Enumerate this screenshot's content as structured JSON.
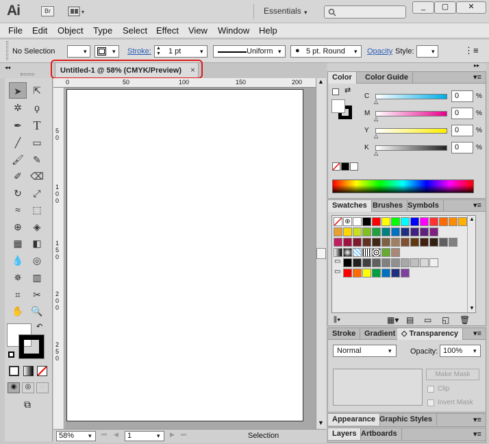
{
  "app": {
    "logo": "Ai",
    "bridge": "Br",
    "workspace": "Essentials"
  },
  "window": {
    "min": "_",
    "max": "▢",
    "close": "✕"
  },
  "menu": [
    "File",
    "Edit",
    "Object",
    "Type",
    "Select",
    "Effect",
    "View",
    "Window",
    "Help"
  ],
  "control": {
    "selection": "No Selection",
    "stroke_label": "Stroke:",
    "stroke_weight": "1 pt",
    "profile": "Uniform",
    "brush": "5 pt. Round",
    "opacity_label": "Opacity",
    "style_label": "Style:"
  },
  "document": {
    "tab_title": "Untitled-1 @ 58% (CMYK/Preview)",
    "close": "×"
  },
  "ruler": {
    "top": [
      "0",
      "50",
      "100",
      "150",
      "200"
    ],
    "left": [
      "5",
      "0",
      "1",
      "0",
      "0",
      "1",
      "5",
      "0",
      "2",
      "0",
      "0",
      "2",
      "5",
      "0"
    ]
  },
  "status": {
    "zoom": "58%",
    "page": "1",
    "mode": "Selection"
  },
  "color_panel": {
    "tabs": [
      "Color",
      "Color Guide"
    ],
    "channels": [
      {
        "label": "C",
        "value": "0",
        "pct": "%",
        "grad": "#00aee8"
      },
      {
        "label": "M",
        "value": "0",
        "pct": "%",
        "grad": "#e8008c"
      },
      {
        "label": "Y",
        "value": "0",
        "pct": "%",
        "grad": "#ffee00"
      },
      {
        "label": "K",
        "value": "0",
        "pct": "%",
        "grad": "#222222"
      }
    ]
  },
  "swatches_panel": {
    "tabs": [
      "Swatches",
      "Brushes",
      "Symbols"
    ],
    "row1": [
      "#000000",
      "#ff0000",
      "#ffff00",
      "#00ff00",
      "#00ffff",
      "#0000ff",
      "#ff00ff",
      "#ff3030",
      "#ff6a00",
      "#ff8c00",
      "#ffb000"
    ],
    "row2": [
      "#e8a030",
      "#ffd700",
      "#c8e020",
      "#80c020",
      "#20a040",
      "#008080",
      "#0070c0",
      "#203080",
      "#402080",
      "#602080",
      "#802080"
    ],
    "row3": [
      "#c02060",
      "#a01040",
      "#801830",
      "#603020",
      "#402818",
      "#806040",
      "#a08060",
      "#805030",
      "#603810",
      "#402010",
      "#302010"
    ],
    "row4": [
      "#606060",
      "#808080",
      "#a0a0a0"
    ],
    "row5": [
      "#000000",
      "#202020",
      "#404040",
      "#606060",
      "#808080",
      "#909090",
      "#a8a8a8",
      "#c0c0c0",
      "#d8d8d8",
      "#f0f0f0"
    ],
    "row6": [
      "#ff0000",
      "#ff6a00",
      "#ffff00",
      "#00a040",
      "#0070c0",
      "#203080",
      "#8040a0"
    ]
  },
  "transparency_panel": {
    "tabs": [
      "Stroke",
      "Gradient",
      "Transparency"
    ],
    "blend": "Normal",
    "opacity_label": "Opacity:",
    "opacity": "100%",
    "make_mask": "Make Mask",
    "clip": "Clip",
    "invert": "Invert Mask"
  },
  "appearance_panel": {
    "tabs": [
      "Appearance",
      "Graphic Styles"
    ]
  },
  "layers_panel": {
    "tabs": [
      "Layers",
      "Artboards"
    ]
  }
}
